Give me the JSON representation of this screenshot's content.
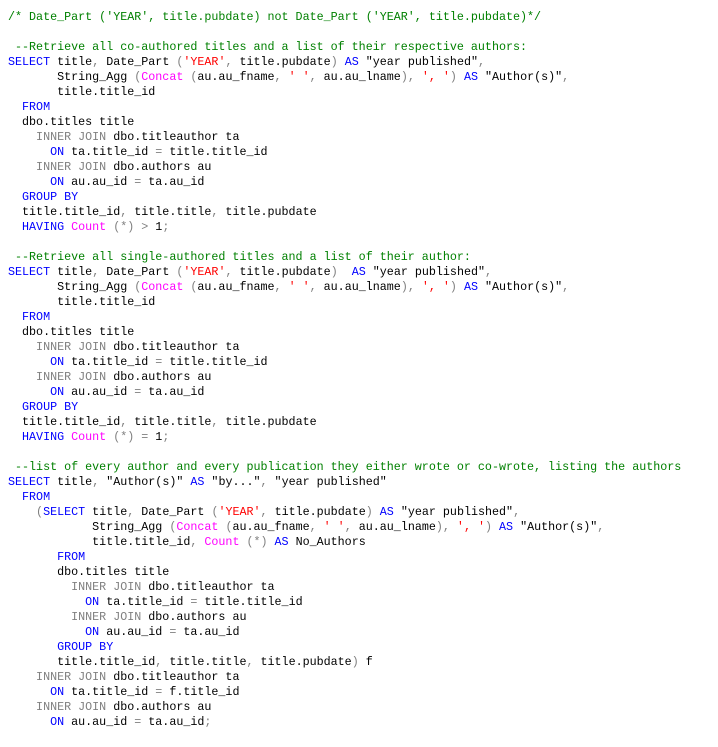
{
  "editor": {
    "language": "SQL",
    "colors": {
      "keyword": "#0000ff",
      "function": "#ff00ff",
      "string": "#ff0000",
      "operator": "#808080",
      "comment": "#008000",
      "identifier": "#000000"
    },
    "lines": [
      [
        [
          "cm",
          "/* Date_Part ('YEAR', title.pubdate) not Date_Part ('YEAR', title.pubdate)*/"
        ]
      ],
      [],
      [
        [
          "cm",
          " --Retrieve all co-authored titles and a list of their respective authors:"
        ]
      ],
      [
        [
          "kw",
          "SELECT"
        ],
        [
          "id",
          " title"
        ],
        [
          "op",
          ","
        ],
        [
          "id",
          " Date_Part "
        ],
        [
          "op",
          "("
        ],
        [
          "str",
          "'YEAR'"
        ],
        [
          "op",
          ","
        ],
        [
          "id",
          " title.pubdate"
        ],
        [
          "op",
          ")"
        ],
        [
          "kw",
          " AS"
        ],
        [
          "id",
          " \"year published\""
        ],
        [
          "op",
          ","
        ]
      ],
      [
        [
          "id",
          "       String_Agg "
        ],
        [
          "op",
          "("
        ],
        [
          "fn",
          "Concat"
        ],
        [
          "op",
          " ("
        ],
        [
          "id",
          "au.au_fname"
        ],
        [
          "op",
          ","
        ],
        [
          "str",
          " ' '"
        ],
        [
          "op",
          ","
        ],
        [
          "id",
          " au.au_lname"
        ],
        [
          "op",
          "),"
        ],
        [
          "str",
          " ', '"
        ],
        [
          "op",
          ")"
        ],
        [
          "kw",
          " AS"
        ],
        [
          "id",
          " \"Author(s)\""
        ],
        [
          "op",
          ","
        ]
      ],
      [
        [
          "id",
          "       title.title_id"
        ]
      ],
      [
        [
          "kw",
          "  FROM"
        ]
      ],
      [
        [
          "id",
          "  dbo.titles title"
        ]
      ],
      [
        [
          "op",
          "    INNER JOIN"
        ],
        [
          "id",
          " dbo.titleauthor ta"
        ]
      ],
      [
        [
          "kw",
          "      ON"
        ],
        [
          "id",
          " ta.title_id "
        ],
        [
          "op",
          "="
        ],
        [
          "id",
          " title.title_id"
        ]
      ],
      [
        [
          "op",
          "    INNER JOIN"
        ],
        [
          "id",
          " dbo.authors au"
        ]
      ],
      [
        [
          "kw",
          "      ON"
        ],
        [
          "id",
          " au.au_id "
        ],
        [
          "op",
          "="
        ],
        [
          "id",
          " ta.au_id"
        ]
      ],
      [
        [
          "kw",
          "  GROUP BY"
        ]
      ],
      [
        [
          "id",
          "  title.title_id"
        ],
        [
          "op",
          ","
        ],
        [
          "id",
          " title.title"
        ],
        [
          "op",
          ","
        ],
        [
          "id",
          " title.pubdate"
        ]
      ],
      [
        [
          "kw",
          "  HAVING"
        ],
        [
          "fn",
          " Count"
        ],
        [
          "op",
          " (*) >"
        ],
        [
          "id",
          " 1"
        ],
        [
          "op",
          ";"
        ]
      ],
      [],
      [
        [
          "cm",
          " --Retrieve all single-authored titles and a list of their author:"
        ]
      ],
      [
        [
          "kw",
          "SELECT"
        ],
        [
          "id",
          " title"
        ],
        [
          "op",
          ","
        ],
        [
          "id",
          " Date_Part "
        ],
        [
          "op",
          "("
        ],
        [
          "str",
          "'YEAR'"
        ],
        [
          "op",
          ","
        ],
        [
          "id",
          " title.pubdate"
        ],
        [
          "op",
          ")"
        ],
        [
          "kw",
          "  AS"
        ],
        [
          "id",
          " \"year published\""
        ],
        [
          "op",
          ","
        ]
      ],
      [
        [
          "id",
          "       String_Agg "
        ],
        [
          "op",
          "("
        ],
        [
          "fn",
          "Concat"
        ],
        [
          "op",
          " ("
        ],
        [
          "id",
          "au.au_fname"
        ],
        [
          "op",
          ","
        ],
        [
          "str",
          " ' '"
        ],
        [
          "op",
          ","
        ],
        [
          "id",
          " au.au_lname"
        ],
        [
          "op",
          "),"
        ],
        [
          "str",
          " ', '"
        ],
        [
          "op",
          ")"
        ],
        [
          "kw",
          " AS"
        ],
        [
          "id",
          " \"Author(s)\""
        ],
        [
          "op",
          ","
        ]
      ],
      [
        [
          "id",
          "       title.title_id"
        ]
      ],
      [
        [
          "kw",
          "  FROM"
        ]
      ],
      [
        [
          "id",
          "  dbo.titles title"
        ]
      ],
      [
        [
          "op",
          "    INNER JOIN"
        ],
        [
          "id",
          " dbo.titleauthor ta"
        ]
      ],
      [
        [
          "kw",
          "      ON"
        ],
        [
          "id",
          " ta.title_id "
        ],
        [
          "op",
          "="
        ],
        [
          "id",
          " title.title_id"
        ]
      ],
      [
        [
          "op",
          "    INNER JOIN"
        ],
        [
          "id",
          " dbo.authors au"
        ]
      ],
      [
        [
          "kw",
          "      ON"
        ],
        [
          "id",
          " au.au_id "
        ],
        [
          "op",
          "="
        ],
        [
          "id",
          " ta.au_id"
        ]
      ],
      [
        [
          "kw",
          "  GROUP BY"
        ]
      ],
      [
        [
          "id",
          "  title.title_id"
        ],
        [
          "op",
          ","
        ],
        [
          "id",
          " title.title"
        ],
        [
          "op",
          ","
        ],
        [
          "id",
          " title.pubdate"
        ]
      ],
      [
        [
          "kw",
          "  HAVING"
        ],
        [
          "fn",
          " Count"
        ],
        [
          "op",
          " (*) ="
        ],
        [
          "id",
          " 1"
        ],
        [
          "op",
          ";"
        ]
      ],
      [],
      [
        [
          "cm",
          " --list of every author and every publication they either wrote or co-wrote, listing the authors"
        ]
      ],
      [
        [
          "kw",
          "SELECT"
        ],
        [
          "id",
          " title"
        ],
        [
          "op",
          ","
        ],
        [
          "id",
          " \"Author(s)\""
        ],
        [
          "kw",
          " AS"
        ],
        [
          "id",
          " \"by...\""
        ],
        [
          "op",
          ","
        ],
        [
          "id",
          " \"year published\""
        ]
      ],
      [
        [
          "kw",
          "  FROM"
        ]
      ],
      [
        [
          "op",
          "    ("
        ],
        [
          "kw",
          "SELECT"
        ],
        [
          "id",
          " title"
        ],
        [
          "op",
          ","
        ],
        [
          "id",
          " Date_Part "
        ],
        [
          "op",
          "("
        ],
        [
          "str",
          "'YEAR'"
        ],
        [
          "op",
          ","
        ],
        [
          "id",
          " title.pubdate"
        ],
        [
          "op",
          ")"
        ],
        [
          "kw",
          " AS"
        ],
        [
          "id",
          " \"year published\""
        ],
        [
          "op",
          ","
        ]
      ],
      [
        [
          "id",
          "            String_Agg "
        ],
        [
          "op",
          "("
        ],
        [
          "fn",
          "Concat"
        ],
        [
          "op",
          " ("
        ],
        [
          "id",
          "au.au_fname"
        ],
        [
          "op",
          ","
        ],
        [
          "str",
          " ' '"
        ],
        [
          "op",
          ","
        ],
        [
          "id",
          " au.au_lname"
        ],
        [
          "op",
          "),"
        ],
        [
          "str",
          " ', '"
        ],
        [
          "op",
          ")"
        ],
        [
          "kw",
          " AS"
        ],
        [
          "id",
          " \"Author(s)\""
        ],
        [
          "op",
          ","
        ]
      ],
      [
        [
          "id",
          "            title.title_id"
        ],
        [
          "op",
          ","
        ],
        [
          "fn",
          " Count"
        ],
        [
          "op",
          " (*)"
        ],
        [
          "kw",
          " AS"
        ],
        [
          "id",
          " No_Authors"
        ]
      ],
      [
        [
          "kw",
          "       FROM"
        ]
      ],
      [
        [
          "id",
          "       dbo.titles title"
        ]
      ],
      [
        [
          "op",
          "         INNER JOIN"
        ],
        [
          "id",
          " dbo.titleauthor ta"
        ]
      ],
      [
        [
          "kw",
          "           ON"
        ],
        [
          "id",
          " ta.title_id "
        ],
        [
          "op",
          "="
        ],
        [
          "id",
          " title.title_id"
        ]
      ],
      [
        [
          "op",
          "         INNER JOIN"
        ],
        [
          "id",
          " dbo.authors au"
        ]
      ],
      [
        [
          "kw",
          "           ON"
        ],
        [
          "id",
          " au.au_id "
        ],
        [
          "op",
          "="
        ],
        [
          "id",
          " ta.au_id"
        ]
      ],
      [
        [
          "kw",
          "       GROUP BY"
        ]
      ],
      [
        [
          "id",
          "       title.title_id"
        ],
        [
          "op",
          ","
        ],
        [
          "id",
          " title.title"
        ],
        [
          "op",
          ","
        ],
        [
          "id",
          " title.pubdate"
        ],
        [
          "op",
          ")"
        ],
        [
          "id",
          " f"
        ]
      ],
      [
        [
          "op",
          "    INNER JOIN"
        ],
        [
          "id",
          " dbo.titleauthor ta"
        ]
      ],
      [
        [
          "kw",
          "      ON"
        ],
        [
          "id",
          " ta.title_id "
        ],
        [
          "op",
          "="
        ],
        [
          "id",
          " f.title_id"
        ]
      ],
      [
        [
          "op",
          "    INNER JOIN"
        ],
        [
          "id",
          " dbo.authors au"
        ]
      ],
      [
        [
          "kw",
          "      ON"
        ],
        [
          "id",
          " au.au_id "
        ],
        [
          "op",
          "="
        ],
        [
          "id",
          " ta.au_id"
        ],
        [
          "op",
          ";"
        ]
      ]
    ]
  }
}
